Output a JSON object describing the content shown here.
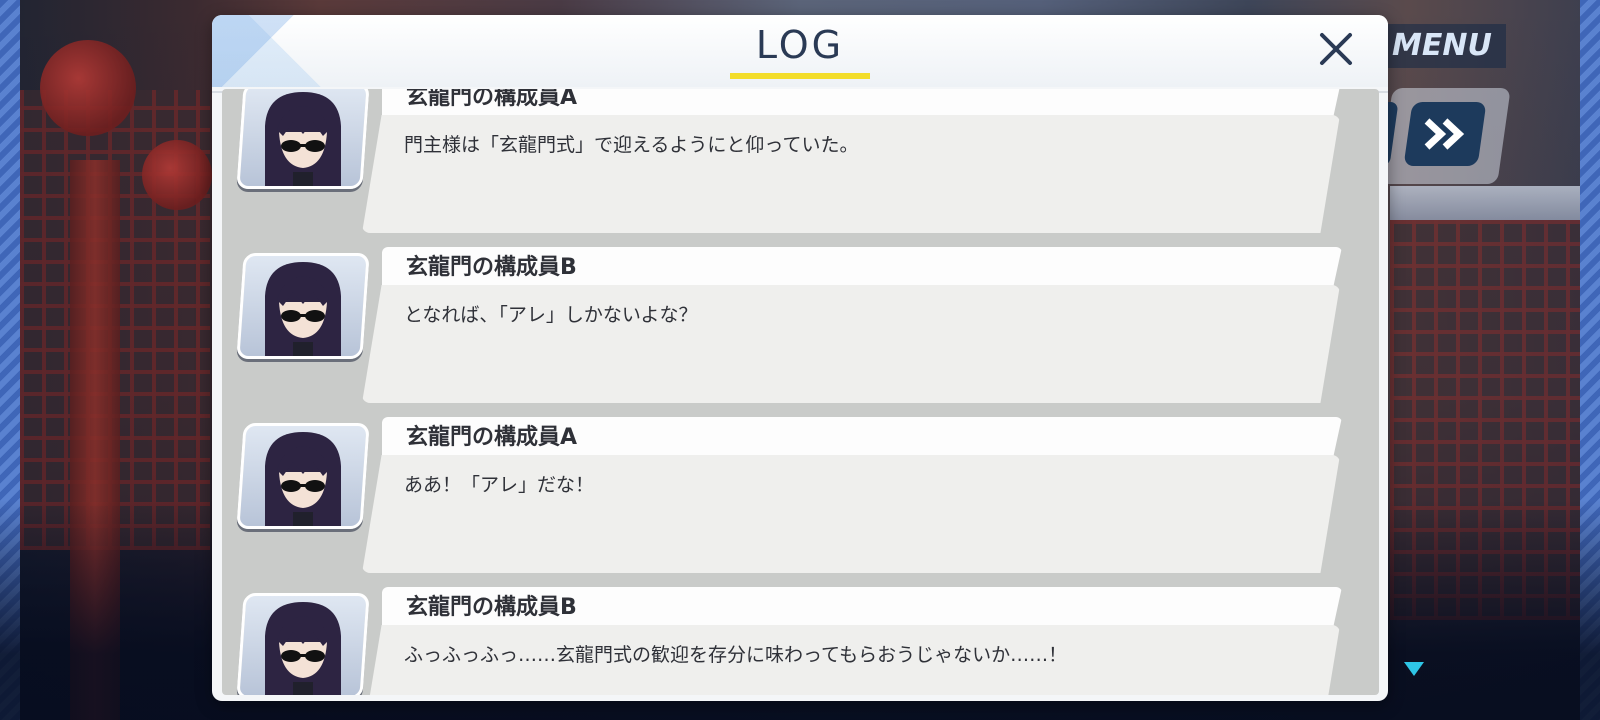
{
  "header": {
    "title": "LOG",
    "close_icon": "close-icon"
  },
  "menu": {
    "label": "MENU",
    "fast_forward_icon": "fast-forward-icon",
    "next_indicator_icon": "next-indicator-icon"
  },
  "log": {
    "entries": [
      {
        "speaker": "玄龍門の構成員A",
        "text": "門主様は「玄龍門式」で迎えるようにと仰っていた。"
      },
      {
        "speaker": "玄龍門の構成員B",
        "text": "となれば、「アレ」しかないよな？"
      },
      {
        "speaker": "玄龍門の構成員A",
        "text": "ああ！「アレ」だな！"
      },
      {
        "speaker": "玄龍門の構成員B",
        "text": "ふっふっふっ……玄龍門式の歓迎を存分に味わってもらおうじゃないか……！"
      }
    ]
  },
  "colors": {
    "title": "#2a3a55",
    "underline": "#f3dd2a",
    "menu_button": "#1d3a5c",
    "indicator": "#2ec5e6"
  }
}
